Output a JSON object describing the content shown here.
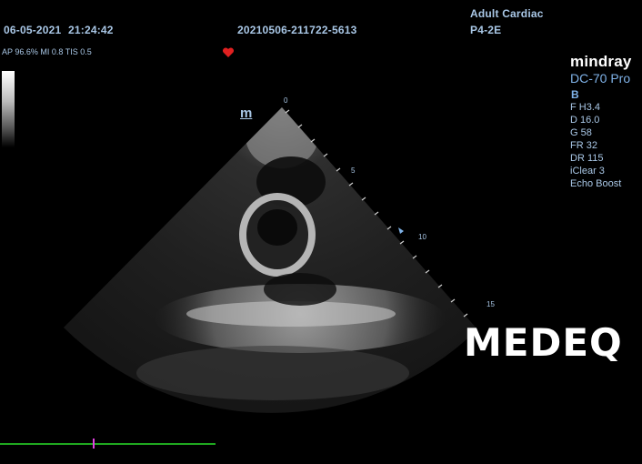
{
  "header": {
    "date": "06-05-2021",
    "time": "21:24:42",
    "study_id": "20210506-211722-5613",
    "preset": "Adult Cardiac",
    "probe": "P4-2E",
    "acoustic": "AP 96.6%  MI 0.8  TIS 0.5"
  },
  "device": {
    "brand": "mindray",
    "model": "DC-70 Pro"
  },
  "params": {
    "mode": "B",
    "freq": "F H3.4",
    "depth": "D 16.0",
    "gain": "G 58",
    "framerate": "FR 32",
    "dynrange": "DR 115",
    "iclear": "iClear 3",
    "echo": "Echo Boost"
  },
  "depth_scale": [
    "0",
    "5",
    "10",
    "15"
  ],
  "m_marker": "m",
  "watermark": "MEDEQ",
  "colors": {
    "text": "#a9c7e6",
    "accent": "#7fb2e8",
    "heart": "#e02020",
    "timeline": "#1fa81f",
    "marker": "#e040e0"
  },
  "icons": [
    "heart-icon",
    "grayscale-bar",
    "m-mode-icon"
  ]
}
